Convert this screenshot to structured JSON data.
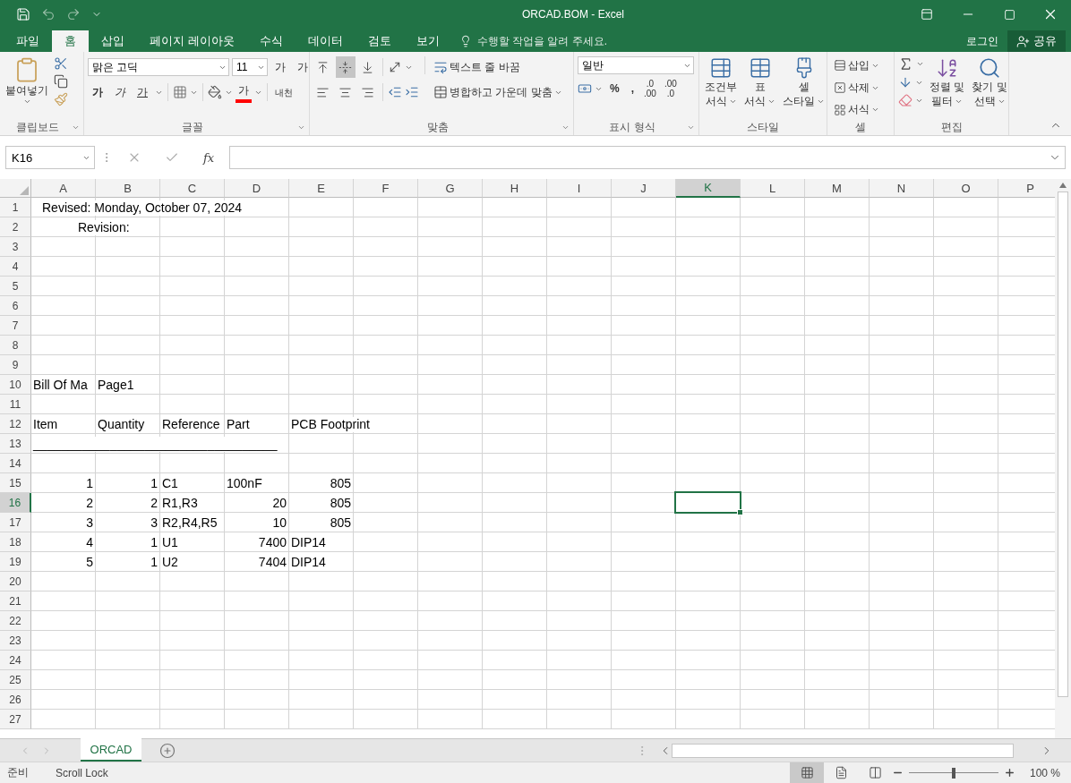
{
  "window": {
    "title": "ORCAD.BOM - Excel"
  },
  "tabs": [
    {
      "label": "파일",
      "selected": false
    },
    {
      "label": "홈",
      "selected": true
    },
    {
      "label": "삽입",
      "selected": false
    },
    {
      "label": "페이지 레이아웃",
      "selected": false
    },
    {
      "label": "수식",
      "selected": false
    },
    {
      "label": "데이터",
      "selected": false
    },
    {
      "label": "검토",
      "selected": false
    },
    {
      "label": "보기",
      "selected": false
    }
  ],
  "tell_me": {
    "placeholder": "수행할 작업을 알려 주세요."
  },
  "account": {
    "sign_in": "로그인",
    "share": "공유"
  },
  "ribbon": {
    "clipboard": {
      "paste": "붙여넣기",
      "label": "클립보드"
    },
    "font": {
      "face": "맑은 고딕",
      "size": "11",
      "grow": "가",
      "shrink": "가",
      "bold": "가",
      "italic": "가",
      "underline": "가",
      "font_color": "가",
      "phonetic": "내천",
      "label": "글꼴"
    },
    "alignment": {
      "vertical": [
        {
          "selected": false
        },
        {
          "selected": true
        },
        {
          "selected": false
        }
      ],
      "horizontal": [
        {
          "selected": false
        },
        {
          "selected": false
        },
        {
          "selected": false
        }
      ],
      "wrap": "텍스트 줄 바꿈",
      "merge": "병합하고 가운데 맞춤",
      "label": "맞춤"
    },
    "number": {
      "format": "일반",
      "percent": "%",
      "comma": ",",
      "increase_decimal": [
        ".0",
        ".00"
      ],
      "decrease_decimal": [
        ".00",
        ".0"
      ],
      "label": "표시 형식"
    },
    "styles": {
      "buttons": [
        {
          "kind": "conditional",
          "lines": [
            "조건부",
            "서식"
          ]
        },
        {
          "kind": "table",
          "lines": [
            "표",
            "서식"
          ]
        },
        {
          "kind": "cell",
          "lines": [
            "셀",
            "스타일"
          ]
        }
      ],
      "label": "스타일"
    },
    "cells": {
      "buttons": [
        {
          "kind": "insert",
          "label": "삽입"
        },
        {
          "kind": "delete",
          "label": "삭제"
        },
        {
          "kind": "format",
          "label": "서식"
        }
      ],
      "label": "셀"
    },
    "editing": {
      "sort": [
        "정렬 및",
        "필터"
      ],
      "find": [
        "찾기 및",
        "선택"
      ],
      "label": "편집"
    }
  },
  "formula_bar": {
    "name_box": "K16",
    "fx": "fx"
  },
  "columns": [
    {
      "label": "A",
      "selected": false
    },
    {
      "label": "B",
      "selected": false
    },
    {
      "label": "C",
      "selected": false
    },
    {
      "label": "D",
      "selected": false
    },
    {
      "label": "E",
      "selected": false
    },
    {
      "label": "F",
      "selected": false
    },
    {
      "label": "G",
      "selected": false
    },
    {
      "label": "H",
      "selected": false
    },
    {
      "label": "I",
      "selected": false
    },
    {
      "label": "J",
      "selected": false
    },
    {
      "label": "K",
      "selected": true
    },
    {
      "label": "L",
      "selected": false
    },
    {
      "label": "M",
      "selected": false
    },
    {
      "label": "N",
      "selected": false
    },
    {
      "label": "O",
      "selected": false
    },
    {
      "label": "P",
      "selected": false
    }
  ],
  "rows": [
    {
      "number": "1",
      "selected": false,
      "cells": [
        {
          "text": "Revised: Monday, October 07, 2024",
          "kind": "title"
        }
      ]
    },
    {
      "number": "2",
      "selected": false,
      "cells": [
        {
          "text": "Revision:",
          "kind": "label"
        }
      ]
    },
    {
      "number": "3",
      "selected": false
    },
    {
      "number": "4",
      "selected": false
    },
    {
      "number": "5",
      "selected": false
    },
    {
      "number": "6",
      "selected": false
    },
    {
      "number": "7",
      "selected": false
    },
    {
      "number": "8",
      "selected": false
    },
    {
      "number": "9",
      "selected": false
    },
    {
      "number": "10",
      "selected": false,
      "cells": [
        {
          "text": "Bill Of Ma",
          "kind": "text"
        },
        {
          "text": "Page1",
          "kind": "text"
        }
      ]
    },
    {
      "number": "11",
      "selected": false
    },
    {
      "number": "12",
      "selected": false,
      "cells": [
        {
          "text": "Item",
          "kind": "text"
        },
        {
          "text": "Quantity",
          "kind": "text"
        },
        {
          "text": "Reference",
          "kind": "text"
        },
        {
          "text": "Part",
          "kind": "text"
        },
        {
          "text": "PCB Footprint",
          "kind": "text"
        }
      ]
    },
    {
      "number": "13",
      "selected": false,
      "cells": [
        {
          "text": "___________________________________",
          "kind": "text"
        }
      ]
    },
    {
      "number": "14",
      "selected": false
    },
    {
      "number": "15",
      "selected": false,
      "cells": [
        {
          "text": "1",
          "kind": "number"
        },
        {
          "text": "1",
          "kind": "number"
        },
        {
          "text": "C1",
          "kind": "text"
        },
        {
          "text": "100nF",
          "kind": "text"
        },
        {
          "text": "805",
          "kind": "number"
        }
      ]
    },
    {
      "number": "16",
      "selected": true,
      "cells": [
        {
          "text": "2",
          "kind": "number"
        },
        {
          "text": "2",
          "kind": "number"
        },
        {
          "text": "R1,R3",
          "kind": "text"
        },
        {
          "text": "20",
          "kind": "number"
        },
        {
          "text": "805",
          "kind": "number"
        }
      ]
    },
    {
      "number": "17",
      "selected": false,
      "cells": [
        {
          "text": "3",
          "kind": "number"
        },
        {
          "text": "3",
          "kind": "number"
        },
        {
          "text": "R2,R4,R5",
          "kind": "text"
        },
        {
          "text": "10",
          "kind": "number"
        },
        {
          "text": "805",
          "kind": "number"
        }
      ]
    },
    {
      "number": "18",
      "selected": false,
      "cells": [
        {
          "text": "4",
          "kind": "number"
        },
        {
          "text": "1",
          "kind": "number"
        },
        {
          "text": "U1",
          "kind": "text"
        },
        {
          "text": "7400",
          "kind": "number"
        },
        {
          "text": "DIP14",
          "kind": "text"
        }
      ]
    },
    {
      "number": "19",
      "selected": false,
      "cells": [
        {
          "text": "5",
          "kind": "number"
        },
        {
          "text": "1",
          "kind": "number"
        },
        {
          "text": "U2",
          "kind": "text"
        },
        {
          "text": "7404",
          "kind": "number"
        },
        {
          "text": "DIP14",
          "kind": "text"
        }
      ]
    },
    {
      "number": "20",
      "selected": false
    },
    {
      "number": "21",
      "selected": false
    },
    {
      "number": "22",
      "selected": false
    },
    {
      "number": "23",
      "selected": false
    },
    {
      "number": "24",
      "selected": false
    },
    {
      "number": "25",
      "selected": false
    },
    {
      "number": "26",
      "selected": false
    },
    {
      "number": "27",
      "selected": false
    }
  ],
  "sheets": [
    {
      "label": "ORCAD",
      "selected": true
    }
  ],
  "status": {
    "mode": "준비",
    "scroll_lock": "Scroll Lock",
    "views": [
      {
        "selected": true
      },
      {
        "selected": false
      },
      {
        "selected": false
      }
    ],
    "zoom": {
      "level": 0.5,
      "reading": "100 %"
    }
  }
}
